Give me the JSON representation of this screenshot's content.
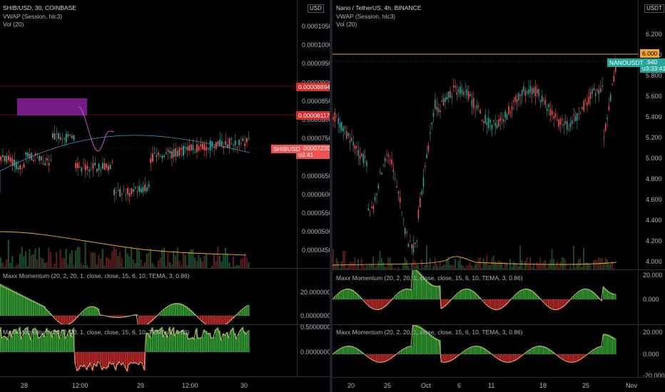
{
  "left_chart": {
    "symbol_line": "SHIB/USD, 30, COINBASE",
    "vwap_line": "VWAP (Session, hlc3)",
    "vol_line": "Vol (20)",
    "currency": "USD",
    "price_ticks": [
      "0.00010500",
      "0.00010000",
      "0.00009500",
      "0.00009000",
      "0.00008500",
      "0.00008000",
      "0.00007500",
      "0.00007000",
      "0.00006500",
      "0.00006000",
      "0.00005500",
      "0.00005000",
      "0.00004500"
    ],
    "tag_high": "0.00008894",
    "tag_mid": "0.00008117",
    "tag_symbol": "SHIBUSD",
    "tag_price": "0.00007220",
    "tag_time": "03:41",
    "momentum1_legend": "Maxx Momentum (20, 2, 20, 1, close, close, 15, 6, 10, TEMA, 3, 0.86)",
    "momentum1_ticks": [
      "20.00000000",
      "0.00000000"
    ],
    "momentum2_legend": "Maxx Momentum (20, 2, 20, 1, close, close, 15, 6, 10, TEMA, 3, 0.86)",
    "momentum2_ticks": [
      "0.50000000",
      "0.00000000"
    ],
    "time_ticks": [
      "28",
      "12:00",
      "29",
      "12:00",
      "30"
    ]
  },
  "right_chart": {
    "symbol_line": "Nano / TetherUS, 4h, BINANCE",
    "vwap_line": "VWAP (Session, hlc3)",
    "vol_line": "Vol (20)",
    "currency": "USDT",
    "price_ticks": [
      "6.200",
      "6.000",
      "5.800",
      "5.600",
      "5.400",
      "5.200",
      "5.000",
      "4.800",
      "4.600",
      "4.400",
      "4.200",
      "4.000"
    ],
    "tag_level": "6.000",
    "tag_symbol": "NANOUSDT",
    "tag_price": "5.940",
    "tag_time": "03:33:41",
    "momentum1_legend": "Maxx Momentum (20, 2, 20, 1, close, close, 15, 6, 10, TEMA, 3, 0.86)",
    "momentum1_ticks": [
      "20.000",
      "0.000"
    ],
    "momentum2_legend": "Maxx Momentum (20, 2, 20, 1, close, close, 15, 6, 10, TEMA, 3, 0.86)",
    "momentum2_ticks": [
      "20.000",
      "0.000",
      "-20.000"
    ],
    "time_ticks": [
      "20",
      "25",
      "Oct",
      "6",
      "11",
      "18",
      "25",
      "Nov"
    ]
  },
  "colors": {
    "up": "#26a69a",
    "down": "#ef5350",
    "level_line": "#f5a623",
    "vwap": "#4a90c2",
    "hist_up": "#3bb33b",
    "hist_down": "#d32f2f",
    "highlight_box": "#9c27b0"
  }
}
